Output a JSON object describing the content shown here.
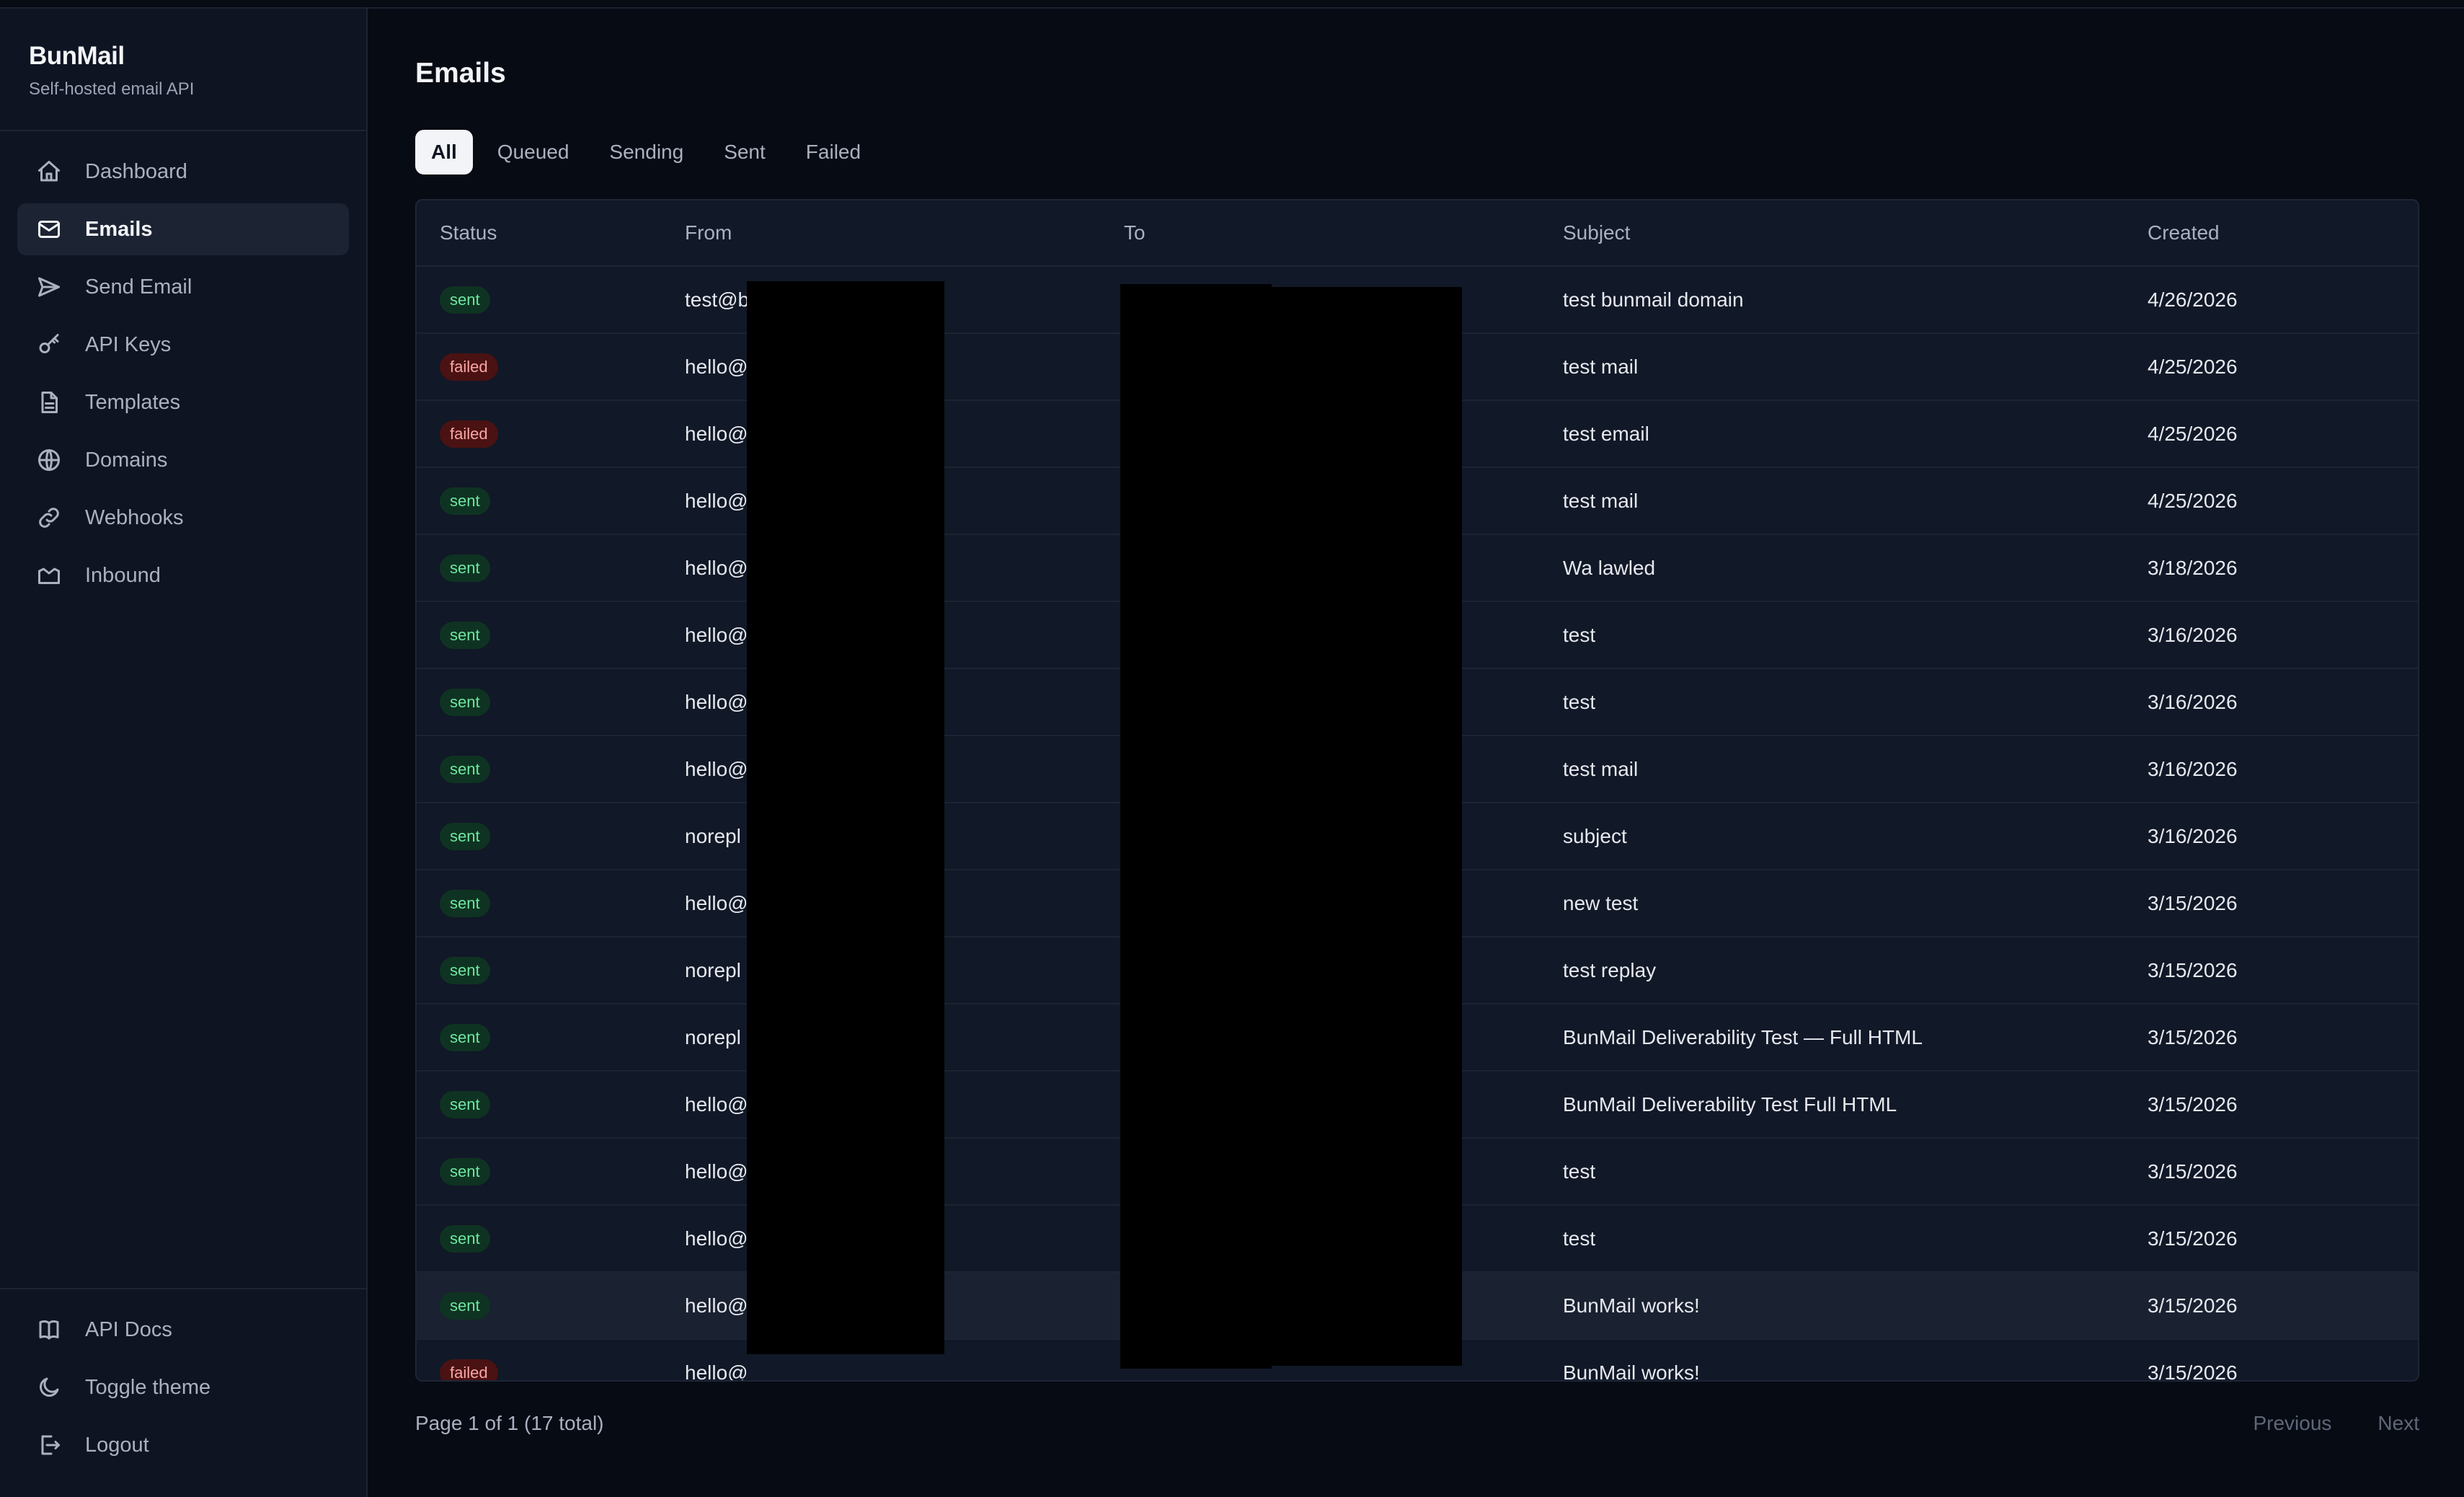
{
  "brand": {
    "name": "BunMail",
    "tagline": "Self-hosted email API"
  },
  "nav": [
    {
      "label": "Dashboard",
      "icon": "home-icon"
    },
    {
      "label": "Emails",
      "icon": "mail-icon",
      "active": true
    },
    {
      "label": "Send Email",
      "icon": "send-icon"
    },
    {
      "label": "API Keys",
      "icon": "key-icon"
    },
    {
      "label": "Templates",
      "icon": "file-icon"
    },
    {
      "label": "Domains",
      "icon": "globe-icon"
    },
    {
      "label": "Webhooks",
      "icon": "link-icon"
    },
    {
      "label": "Inbound",
      "icon": "inbox-icon"
    }
  ],
  "nav_bottom": [
    {
      "label": "API Docs",
      "icon": "book-icon"
    },
    {
      "label": "Toggle theme",
      "icon": "moon-icon"
    },
    {
      "label": "Logout",
      "icon": "logout-icon"
    }
  ],
  "page": {
    "title": "Emails"
  },
  "tabs": [
    {
      "label": "All",
      "active": true
    },
    {
      "label": "Queued"
    },
    {
      "label": "Sending"
    },
    {
      "label": "Sent"
    },
    {
      "label": "Failed"
    }
  ],
  "table": {
    "headers": {
      "status": "Status",
      "from": "From",
      "to": "To",
      "subject": "Subject",
      "created": "Created"
    },
    "rows": [
      {
        "status": "sent",
        "from": "test@b",
        "to": "",
        "subject": "test bunmail domain",
        "created": "4/26/2026"
      },
      {
        "status": "failed",
        "from": "hello@",
        "to": "",
        "subject": "test mail",
        "created": "4/25/2026"
      },
      {
        "status": "failed",
        "from": "hello@",
        "to": "",
        "subject": "test email",
        "created": "4/25/2026"
      },
      {
        "status": "sent",
        "from": "hello@",
        "to": "",
        "subject": "test mail",
        "created": "4/25/2026"
      },
      {
        "status": "sent",
        "from": "hello@",
        "to": "",
        "subject": "Wa lawled",
        "created": "3/18/2026"
      },
      {
        "status": "sent",
        "from": "hello@",
        "to": "",
        "subject": "test",
        "created": "3/16/2026"
      },
      {
        "status": "sent",
        "from": "hello@",
        "to": "",
        "subject": "test",
        "created": "3/16/2026"
      },
      {
        "status": "sent",
        "from": "hello@",
        "to": "",
        "subject": "test mail",
        "created": "3/16/2026"
      },
      {
        "status": "sent",
        "from": "norepl",
        "to": "",
        "subject": "subject",
        "created": "3/16/2026"
      },
      {
        "status": "sent",
        "from": "hello@",
        "to": "",
        "subject": "new test",
        "created": "3/15/2026"
      },
      {
        "status": "sent",
        "from": "norepl",
        "to": "",
        "subject": "test replay",
        "created": "3/15/2026"
      },
      {
        "status": "sent",
        "from": "norepl",
        "to": "",
        "subject": "BunMail Deliverability Test — Full HTML",
        "created": "3/15/2026"
      },
      {
        "status": "sent",
        "from": "hello@",
        "to": "",
        "subject": "BunMail Deliverability Test Full HTML",
        "created": "3/15/2026"
      },
      {
        "status": "sent",
        "from": "hello@",
        "to": "",
        "subject": "test",
        "created": "3/15/2026"
      },
      {
        "status": "sent",
        "from": "hello@",
        "to": "",
        "subject": "test",
        "created": "3/15/2026"
      },
      {
        "status": "sent",
        "from": "hello@",
        "to": "",
        "subject": "BunMail works!",
        "created": "3/15/2026",
        "highlighted": true
      },
      {
        "status": "failed",
        "from": "hello@",
        "to": "",
        "subject": "BunMail works!",
        "created": "3/15/2026"
      }
    ]
  },
  "pagination": {
    "info": "Page 1 of 1 (17 total)",
    "previous": "Previous",
    "next": "Next"
  },
  "colors": {
    "background": "#070b14",
    "sidebar": "#0e1422",
    "sent_badge": "#0f3322",
    "failed_badge": "#4a1212"
  }
}
